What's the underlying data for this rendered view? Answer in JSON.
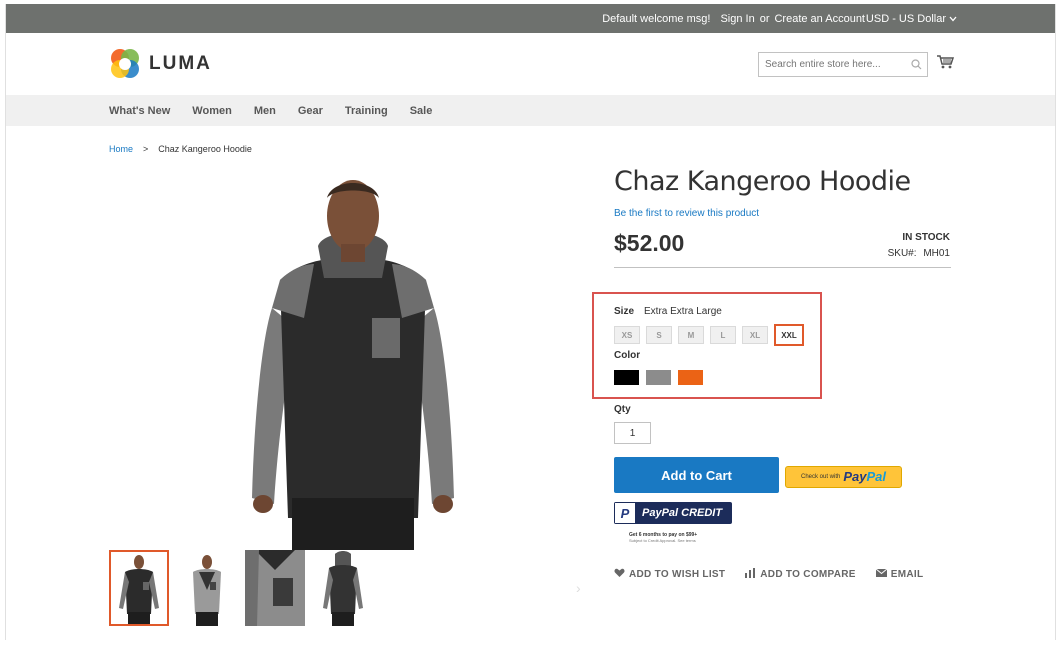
{
  "topbar": {
    "welcome": "Default welcome msg!",
    "sign_in": "Sign In",
    "or": "or",
    "create_account": "Create an Account",
    "currency": "USD - US Dollar"
  },
  "header": {
    "logo_text": "LUMA",
    "search_placeholder": "Search entire store here..."
  },
  "nav": {
    "items": [
      "What's New",
      "Women",
      "Men",
      "Gear",
      "Training",
      "Sale"
    ]
  },
  "breadcrumb": {
    "home": "Home",
    "separator": ">",
    "current": "Chaz Kangeroo Hoodie"
  },
  "product": {
    "title": "Chaz Kangeroo Hoodie",
    "review_link": "Be the first to review this product",
    "price": "$52.00",
    "stock": "IN STOCK",
    "sku_label": "SKU#:",
    "sku": "MH01",
    "size_label": "Size",
    "size_value": "Extra Extra Large",
    "sizes": [
      "XS",
      "S",
      "M",
      "L",
      "XL",
      "XXL"
    ],
    "selected_size": "XXL",
    "color_label": "Color",
    "colors": [
      "#000000",
      "#8c8c8c",
      "#eb6315"
    ],
    "qty_label": "Qty",
    "qty_value": "1",
    "add_to_cart": "Add to Cart",
    "paypal_small": "Check out with",
    "paypal_pay": "Pay",
    "paypal_pal": "Pal",
    "paypal_credit": "PayPal CREDIT",
    "credit_note": "Get 6 months to pay on $99+",
    "credit_note2": "Subject to Credit Approval. See terms",
    "wishlist": "ADD TO WISH LIST",
    "compare": "ADD TO COMPARE",
    "email": "EMAIL"
  },
  "colors": {
    "topbar": "#6e716e",
    "accent_blue": "#1979c3",
    "highlight_red": "#d9534f",
    "selected_orange": "#e0592a"
  }
}
